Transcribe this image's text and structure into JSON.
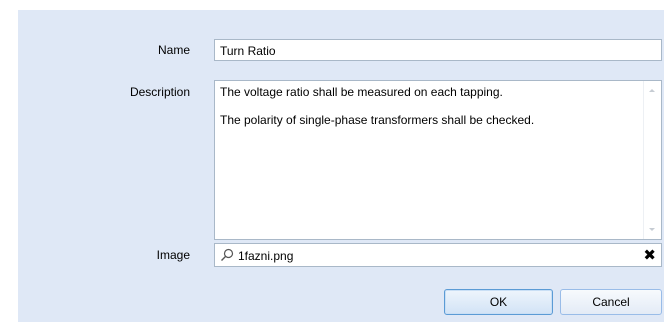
{
  "form": {
    "name_label": "Name",
    "name_value": "Turn Ratio",
    "description_label": "Description",
    "description_value": "The voltage ratio shall be measured on each tapping.\n\nThe polarity of single-phase transformers shall be checked.",
    "image_label": "Image",
    "image_value": "1fazni.png",
    "image_clear_glyph": "✖"
  },
  "buttons": {
    "ok_label": "OK",
    "cancel_label": "Cancel"
  },
  "colors": {
    "dialog_background": "#dfe8f6",
    "field_border": "#a9b8c8",
    "button_border": "#99bce8"
  },
  "icons": {
    "image_search": "search-icon",
    "image_clear": "close-icon"
  }
}
